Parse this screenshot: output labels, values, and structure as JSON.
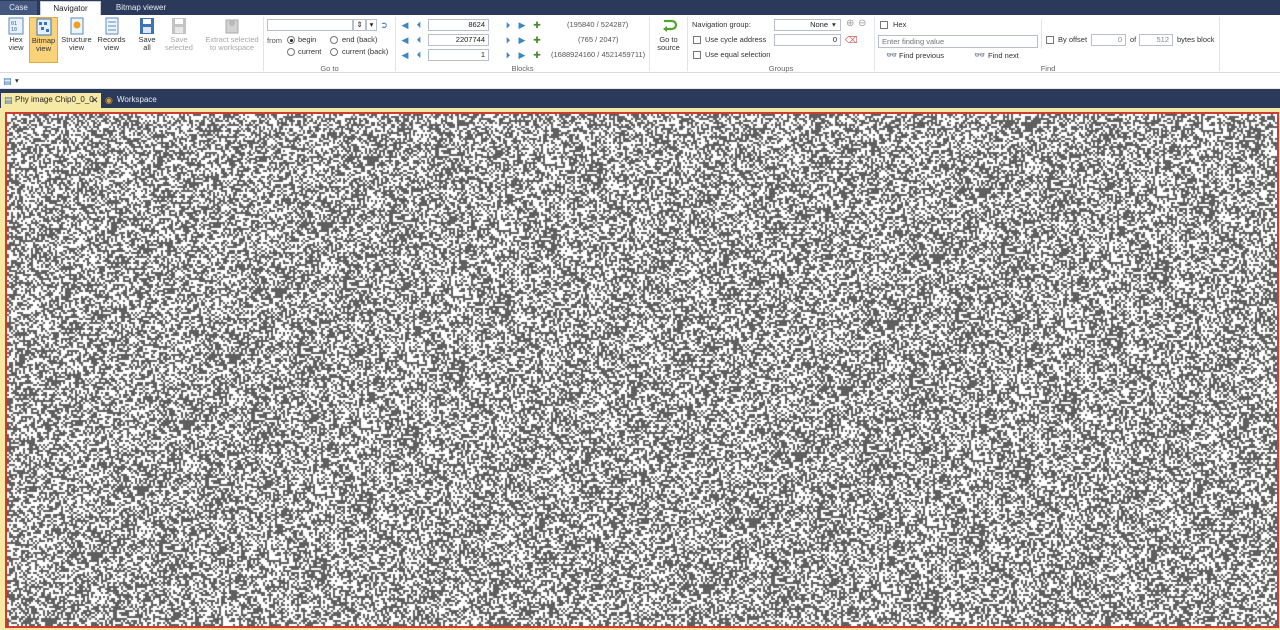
{
  "ribbon_tabs": [
    "Case",
    "Navigator",
    "Bitmap viewer"
  ],
  "views": {
    "hex": "Hex view",
    "bitmap": "Bitmap view",
    "structure": "Structure view",
    "records": "Records view",
    "save_all": "Save all",
    "save_selected": "Save selected",
    "extract_selected": "Extract selected to workspace"
  },
  "goto": {
    "group_label": "Go to",
    "address_value": "",
    "from_label": "from",
    "begin": "begin",
    "end_back": "end (back)",
    "current": "current",
    "current_back": "current (back)",
    "selected_origin": "begin"
  },
  "blocks": {
    "group_label": "Blocks",
    "row1_value": "8624",
    "row1_info": "(195840 / 524287)",
    "row2_value": "2207744",
    "row2_info": "(765 / 2047)",
    "row3_value": "1",
    "row3_info": "(1688924160 / 4521459711)"
  },
  "go_to_source": "Go to source",
  "groups": {
    "group_label": "Groups",
    "navigation_group_label": "Navigation group:",
    "navigation_group_value": "None",
    "cycle_address_label": "Use cycle address",
    "cycle_address_value": "0",
    "equal_selection_label": "Use equal selection"
  },
  "find": {
    "group_label": "Find",
    "hex_label": "Hex",
    "placeholder": "Enter finding value",
    "find_previous": "Find previous",
    "find_next": "Find next",
    "by_offset_label": "By offset",
    "offset_value": "0",
    "of_label": "of",
    "block_size_value": "512",
    "bytes_block_label": "bytes block"
  },
  "document_tabs": {
    "active": "Phy image Chip0_0_0",
    "workspace": "Workspace"
  },
  "colors": {
    "chrome": "#2b3a5b",
    "selected_button": "#f9d27a",
    "frame_border": "#d13a2f",
    "pixel_dark": "#5f5f5f",
    "pixel_light": "#ffffff"
  }
}
